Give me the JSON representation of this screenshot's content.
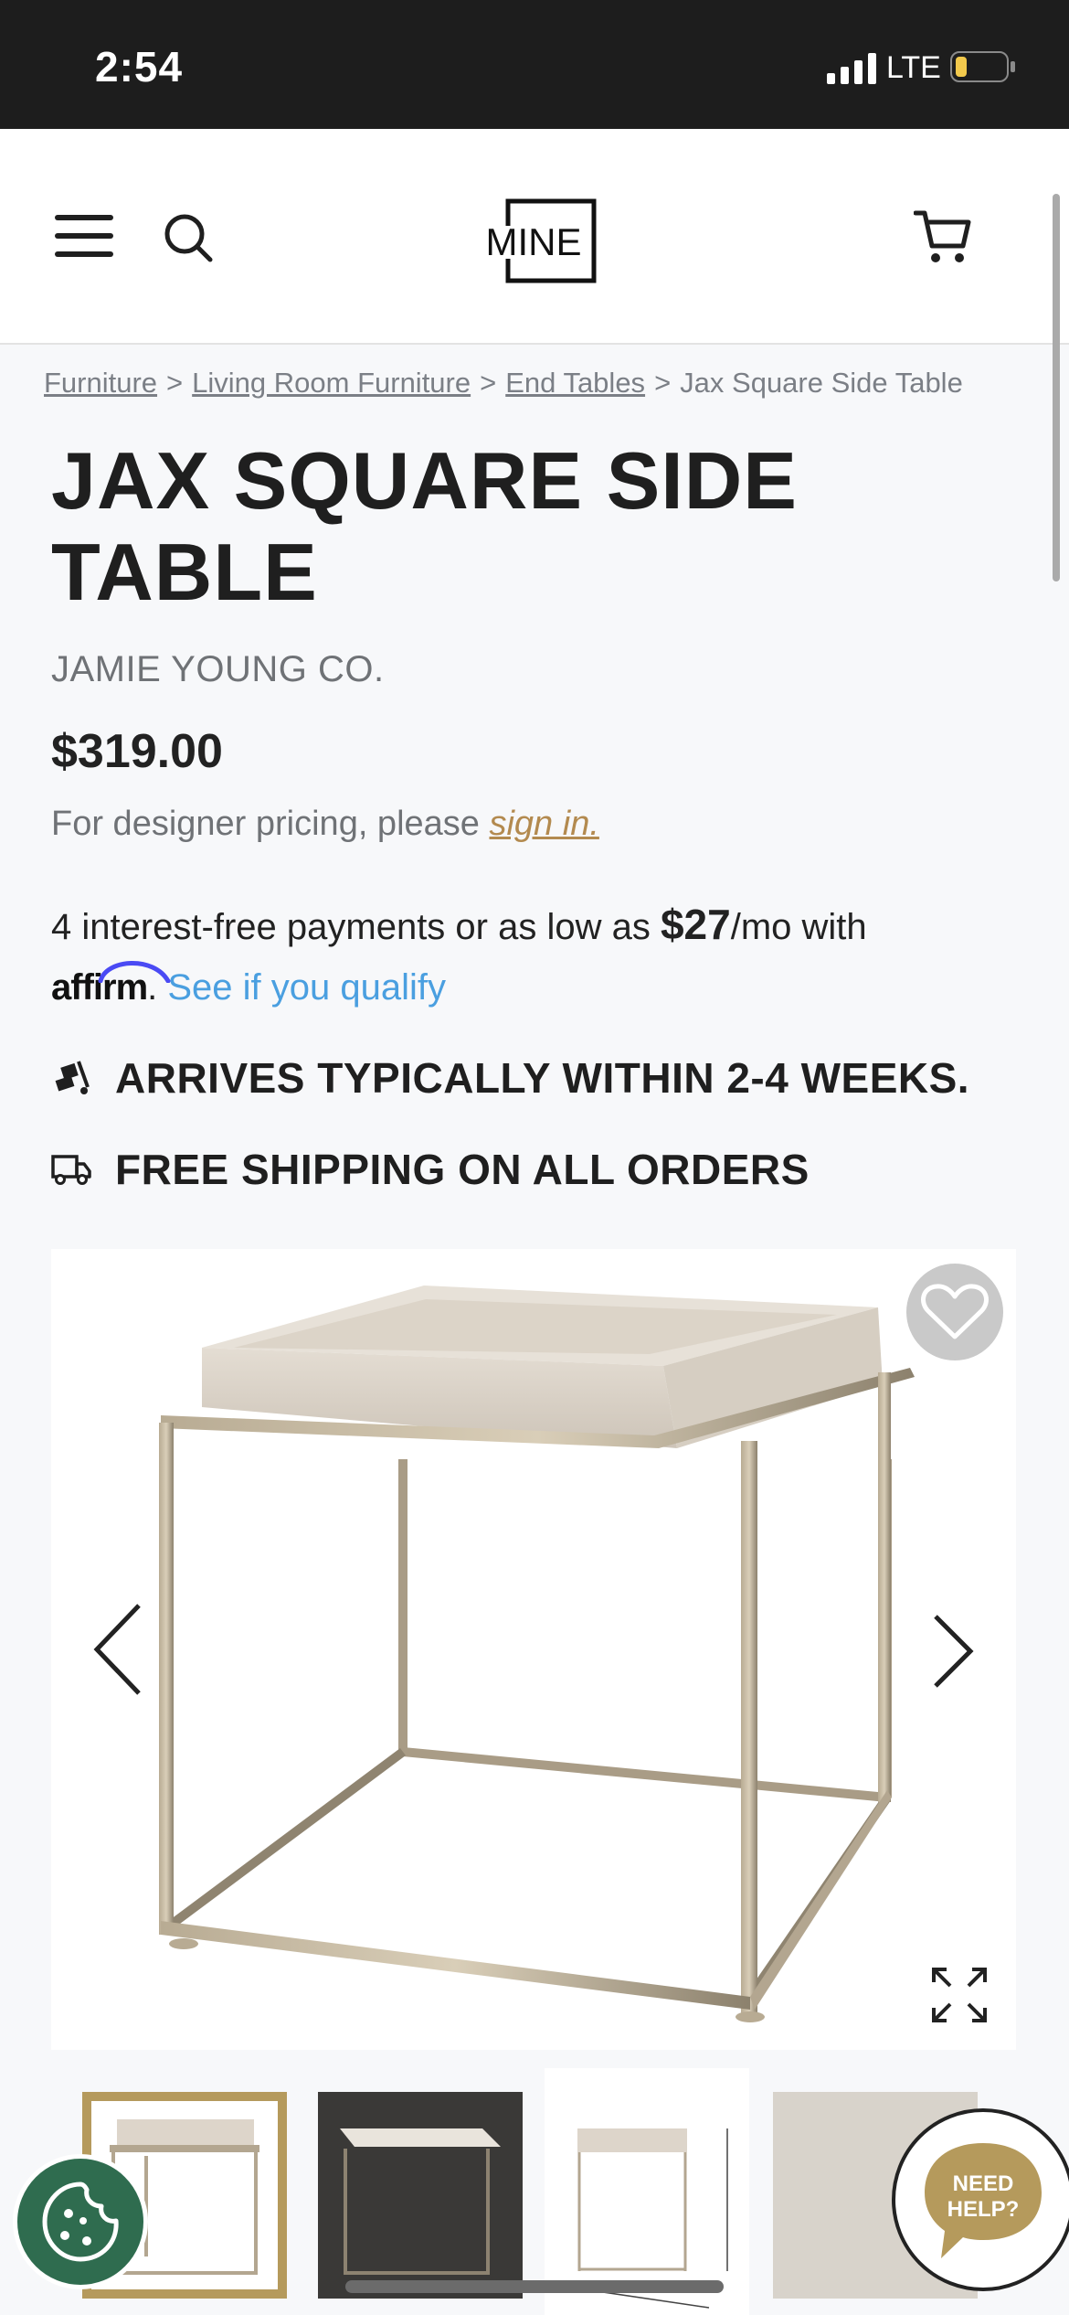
{
  "status_bar": {
    "time": "2:54",
    "network": "LTE"
  },
  "header": {
    "logo_text": "MINE"
  },
  "breadcrumb": [
    {
      "label": "Furniture"
    },
    {
      "label": "Living Room Furniture"
    },
    {
      "label": "End Tables"
    },
    {
      "label": "Jax Square Side Table"
    }
  ],
  "product": {
    "title": "JAX SQUARE SIDE TABLE",
    "brand": "JAMIE YOUNG CO.",
    "price": "$319.00",
    "designer_prefix": "For designer pricing, please ",
    "designer_link": "sign in."
  },
  "affirm": {
    "text_before": "4 interest-free payments or as low as ",
    "amount": "$27",
    "text_after": "/mo with",
    "logo": "affirm",
    "qualify_link": "See if you qualify"
  },
  "shipping": {
    "arrival": "ARRIVES TYPICALLY WITHIN 2-4 WEEKS.",
    "free_shipping": "FREE SHIPPING ON ALL ORDERS"
  },
  "help_button": {
    "line1": "NEED",
    "line2": "HELP?"
  },
  "colors": {
    "accent_gold": "#b38a4f",
    "link_blue": "#4a9fe0",
    "cookie_green": "#2f6c4f",
    "help_gold": "#b59a5c"
  }
}
